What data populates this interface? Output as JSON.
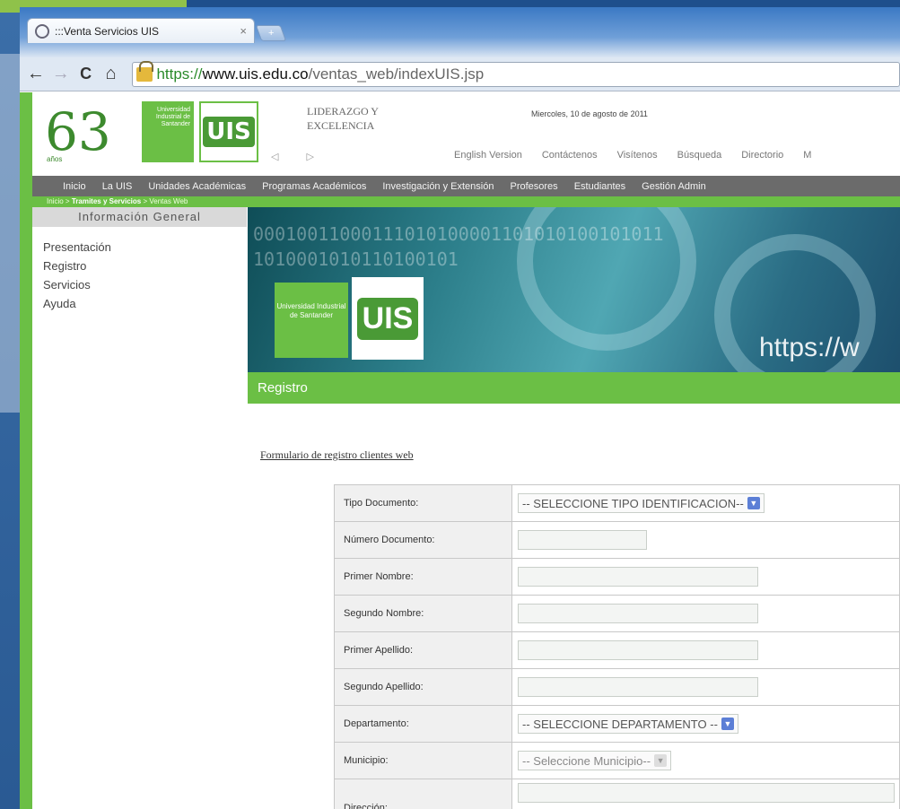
{
  "browser": {
    "tab_title": ":::Venta Servicios UIS",
    "tab_close": "×",
    "new_tab": "+",
    "back": "←",
    "forward": "→",
    "reload": "C",
    "home": "⌂",
    "url_scheme": "https://",
    "url_host": "www.uis.edu.co",
    "url_path": "/ventas_web/indexUIS.jsp"
  },
  "header": {
    "logo_number": "63",
    "logo_sub": "años",
    "university": "Universidad Industrial de Santander",
    "uis_mark": "UIS",
    "motto_line1": "LIDERAZGO Y",
    "motto_line2": "EXCELENCIA",
    "date": "Miercoles, 10 de agosto de 2011",
    "arrows": "◁ ▷",
    "top_links": [
      "English Version",
      "Contáctenos",
      "Visítenos",
      "Búsqueda",
      "Directorio",
      "M"
    ]
  },
  "main_nav": [
    "Inicio",
    "La UIS",
    "Unidades Académicas",
    "Programas Académicos",
    "Investigación y Extensión",
    "Profesores",
    "Estudiantes",
    "Gestión Admin"
  ],
  "breadcrumb": {
    "home": "Inicio",
    "sep": ">",
    "section": "Tramites y Servicios",
    "current": "Ventas Web"
  },
  "sidebar": {
    "title": "Información General",
    "items": [
      "Presentación",
      "Registro",
      "Servicios",
      "Ayuda"
    ]
  },
  "banner": {
    "binary_line1": "00010011000111010100001101010100101011",
    "binary_line2": "1010001010110100101",
    "university": "Universidad Industrial de Santander",
    "uis_mark": "UIS",
    "url_text": "https://w"
  },
  "section_title": "Registro",
  "form": {
    "title": "Formulario de registro clientes web",
    "fields": [
      {
        "label": "Tipo Documento:",
        "type": "select",
        "value": "-- SELECCIONE TIPO IDENTIFICACION--"
      },
      {
        "label": "Número Documento:",
        "type": "input",
        "value": ""
      },
      {
        "label": "Primer Nombre:",
        "type": "input",
        "value": ""
      },
      {
        "label": "Segundo Nombre:",
        "type": "input",
        "value": ""
      },
      {
        "label": "Primer Apellido:",
        "type": "input",
        "value": ""
      },
      {
        "label": "Segundo Apellido:",
        "type": "input",
        "value": ""
      },
      {
        "label": "Departamento:",
        "type": "select",
        "value": "-- SELECCIONE DEPARTAMENTO --"
      },
      {
        "label": "Municipio:",
        "type": "select",
        "value": "-- Seleccione Municipio--"
      },
      {
        "label": "Dirección:",
        "type": "input",
        "value": ""
      }
    ],
    "chevron": "▼"
  }
}
